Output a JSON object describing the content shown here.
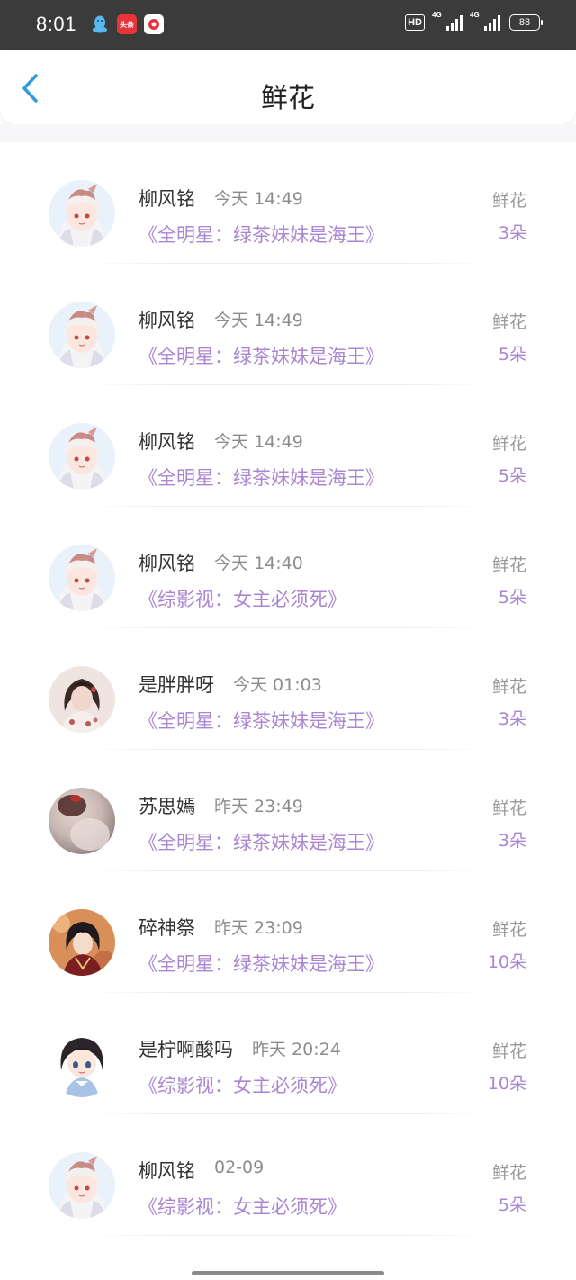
{
  "status_bar": {
    "time": "8:01",
    "toutiao_label": "头条",
    "hd_label": "HD",
    "signal_1_label": "4G",
    "signal_2_label": "4G",
    "battery_level": "88"
  },
  "header": {
    "title": "鲜花"
  },
  "colors": {
    "accent_purple": "#a985d2",
    "back_arrow_blue": "#2f9be0",
    "status_bar_bg": "#3b3b3b"
  },
  "items": [
    {
      "user": "柳风铭",
      "time": "今天 14:49",
      "book": "《全明星：绿茶妹妹是海王》",
      "gift": "鲜花",
      "count": "3朵",
      "avatar": "anime-white-hair"
    },
    {
      "user": "柳风铭",
      "time": "今天 14:49",
      "book": "《全明星：绿茶妹妹是海王》",
      "gift": "鲜花",
      "count": "5朵",
      "avatar": "anime-white-hair"
    },
    {
      "user": "柳风铭",
      "time": "今天 14:49",
      "book": "《全明星：绿茶妹妹是海王》",
      "gift": "鲜花",
      "count": "5朵",
      "avatar": "anime-white-hair"
    },
    {
      "user": "柳风铭",
      "time": "今天 14:40",
      "book": "《综影视：女主必须死》",
      "gift": "鲜花",
      "count": "5朵",
      "avatar": "anime-white-hair"
    },
    {
      "user": "是胖胖呀",
      "time": "今天 01:03",
      "book": "《全明星：绿茶妹妹是海王》",
      "gift": "鲜花",
      "count": "3朵",
      "avatar": "vintage-lady"
    },
    {
      "user": "苏思嫣",
      "time": "昨天 23:49",
      "book": "《全明星：绿茶妹妹是海王》",
      "gift": "鲜花",
      "count": "3朵",
      "avatar": "blurred-portrait"
    },
    {
      "user": "碎神祭",
      "time": "昨天 23:09",
      "book": "《全明星：绿茶妹妹是海王》",
      "gift": "鲜花",
      "count": "10朵",
      "avatar": "dark-hair-warrior"
    },
    {
      "user": "是柠啊酸吗",
      "time": "昨天 20:24",
      "book": "《综影视：女主必须死》",
      "gift": "鲜花",
      "count": "10朵",
      "avatar": "chibi-girl"
    },
    {
      "user": "柳风铭",
      "time": "02-09",
      "book": "《综影视：女主必须死》",
      "gift": "鲜花",
      "count": "5朵",
      "avatar": "anime-white-hair"
    }
  ]
}
